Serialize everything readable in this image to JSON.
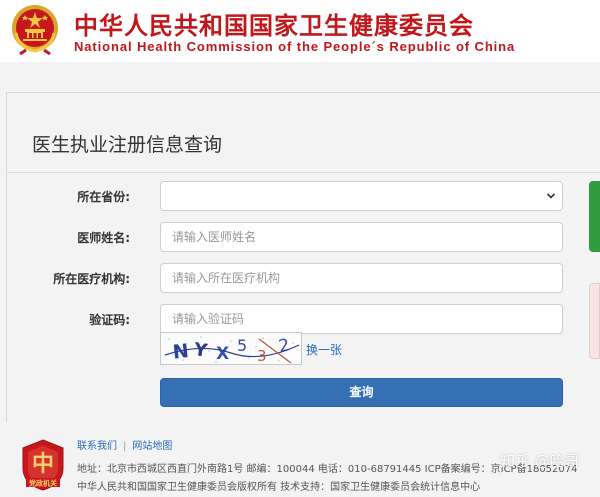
{
  "header": {
    "title_cn": "中华人民共和国国家卫生健康委员会",
    "title_en": "National Health Commission of the People´s Republic of China",
    "emblem_icon": "national-emblem-icon",
    "brand_color": "#c0171b"
  },
  "page": {
    "title": "医生执业注册信息查询"
  },
  "form": {
    "province": {
      "label": "所在省份:",
      "value": ""
    },
    "doctor_name": {
      "label": "医师姓名:",
      "placeholder": "请输入医师姓名",
      "value": ""
    },
    "institution": {
      "label": "所在医疗机构:",
      "placeholder": "请输入所在医疗机构",
      "value": ""
    },
    "captcha": {
      "label": "验证码:",
      "placeholder": "请输入验证码",
      "value": "",
      "image_text": "NYX5 3 2",
      "refresh_label": "换一张"
    },
    "submit_label": "查询",
    "submit_color": "#356fb4"
  },
  "footer": {
    "links": [
      "联系我们",
      "网站地图"
    ],
    "address_line": "地址：北京市西城区西直门外南路1号    邮编：100044    电话：010-68791445    ICP备案编号：京ICP备18052074",
    "copyright_line": "中华人民共和国国家卫生健康委员会版权所有    技术支持：国家卫生健康委员会统计信息中心",
    "logo_text": "党政机关",
    "logo_icon": "party-govt-agency-icon"
  },
  "watermark": "知乎 @哈哥"
}
